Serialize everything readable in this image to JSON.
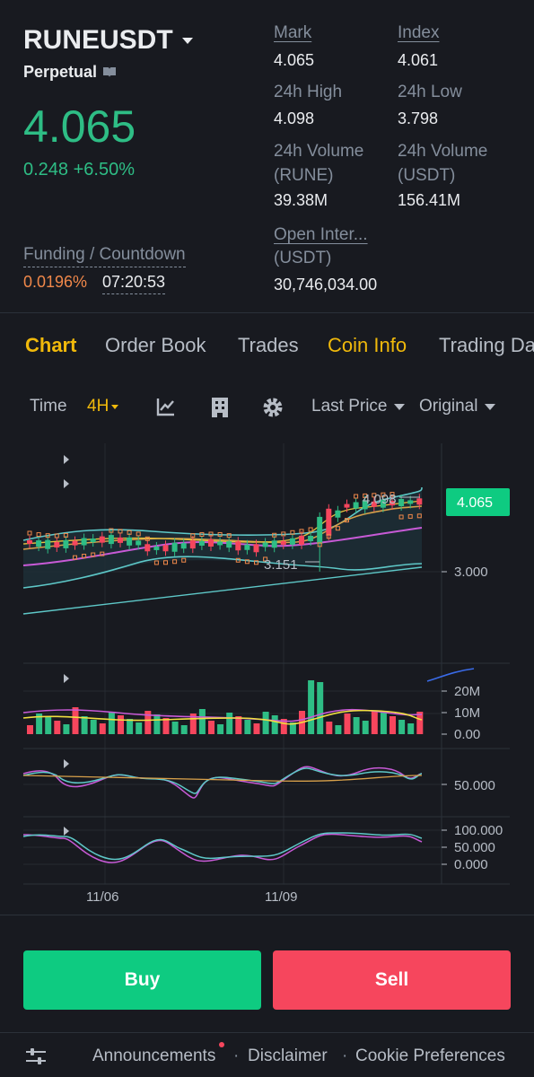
{
  "header": {
    "symbol": "RUNEUSDT",
    "contract_type": "Perpetual",
    "last_price": "4.065",
    "change": "0.248 +6.50%",
    "funding_label": "Funding / Countdown",
    "funding_rate": "0.0196%",
    "countdown": "07:20:53"
  },
  "stats": {
    "mark_label": "Mark",
    "mark_value": "4.065",
    "index_label": "Index",
    "index_value": "4.061",
    "high_label": "24h High",
    "high_value": "4.098",
    "low_label": "24h Low",
    "low_value": "3.798",
    "vol_rune_label_1": "24h Volume",
    "vol_rune_label_2": "(RUNE)",
    "vol_rune_value": "39.38M",
    "vol_usdt_label_1": "24h Volume",
    "vol_usdt_label_2": "(USDT)",
    "vol_usdt_value": "156.41M",
    "oi_label_1": "Open Inter...",
    "oi_label_2": "(USDT)",
    "oi_value": "30,746,034.00"
  },
  "tabs": [
    "Chart",
    "Order Book",
    "Trades",
    "Coin Info",
    "Trading Da"
  ],
  "toolbar": {
    "time_label": "Time",
    "interval": "4H",
    "price_type": "Last Price",
    "view": "Original"
  },
  "chart_data": {
    "type": "candlestick",
    "price_axis": {
      "ticks": [
        "3.000"
      ],
      "current_price_label": "4.065",
      "high_marker": "4.098",
      "low_marker": "3.151"
    },
    "volume_axis": {
      "ticks": [
        "20M",
        "10M",
        "0.00"
      ]
    },
    "indicator1_axis": {
      "ticks": [
        "50.000"
      ]
    },
    "indicator2_axis": {
      "ticks": [
        "100.000",
        "50.000",
        "0.000"
      ]
    },
    "x_ticks": [
      "11/06",
      "11/09"
    ],
    "colors": {
      "up": "#2ebd85",
      "down": "#f6465d"
    }
  },
  "actions": {
    "buy": "Buy",
    "sell": "Sell"
  },
  "footer": {
    "items": [
      "Announcements",
      "Disclaimer",
      "Cookie Preferences"
    ]
  }
}
